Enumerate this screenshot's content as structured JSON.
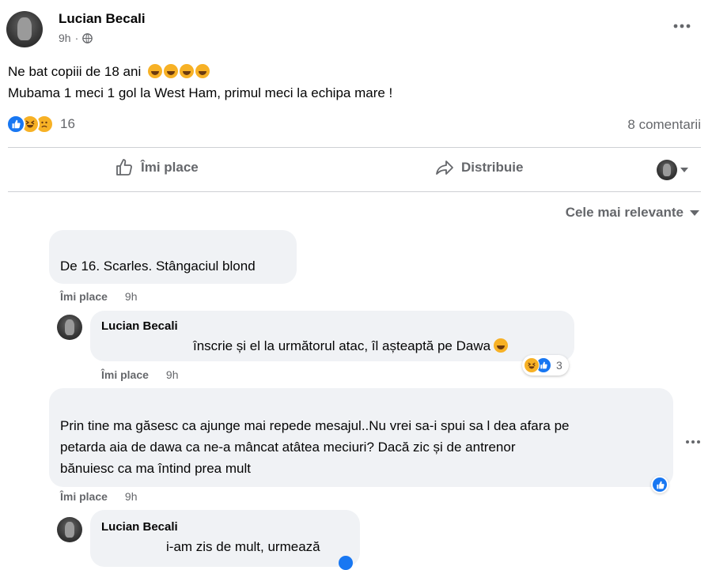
{
  "post": {
    "author": "Lucian Becali",
    "time": "9h",
    "text_line1": "Ne bat copiii de 18 ani",
    "text_line2": "Mubama 1 meci 1 gol la West Ham, primul meci la echipa mare !",
    "emoji_count": 4,
    "reaction_count": "16",
    "comments_count": "8 comentarii",
    "options_icon": "more-horizontal-icon"
  },
  "actions": {
    "like_label": "Îmi place",
    "share_label": "Distribuie"
  },
  "sort": {
    "label": "Cele mai relevante"
  },
  "comments": [
    {
      "author": "",
      "text": "De 16. Scarles. Stângaciul blond",
      "like_label": "Îmi place",
      "time": "9h"
    },
    {
      "author": "Lucian Becali",
      "text": "înscrie și el la următorul atac, îl așteaptă pe Dawa",
      "like_label": "Îmi place",
      "time": "9h",
      "reaction_count": "3"
    },
    {
      "author": "",
      "text_line1": "Prin tine ma găsesc ca ajunge mai repede mesajul..Nu vrei sa-i spui sa l dea afara pe",
      "text_line2": "petarda aia de dawa ca ne-a mâncat atâtea meciuri? Dacă zic și de antrenor",
      "text_line3": "bănuiesc ca ma întind prea mult",
      "like_label": "Îmi place",
      "time": "9h"
    },
    {
      "author": "Lucian Becali",
      "text": "i-am zis de mult, urmează"
    }
  ],
  "colors": {
    "brand": "#1877f2",
    "muted": "#65676b",
    "bubble": "#f0f2f5",
    "reaction_yellow": "#f7b125"
  }
}
